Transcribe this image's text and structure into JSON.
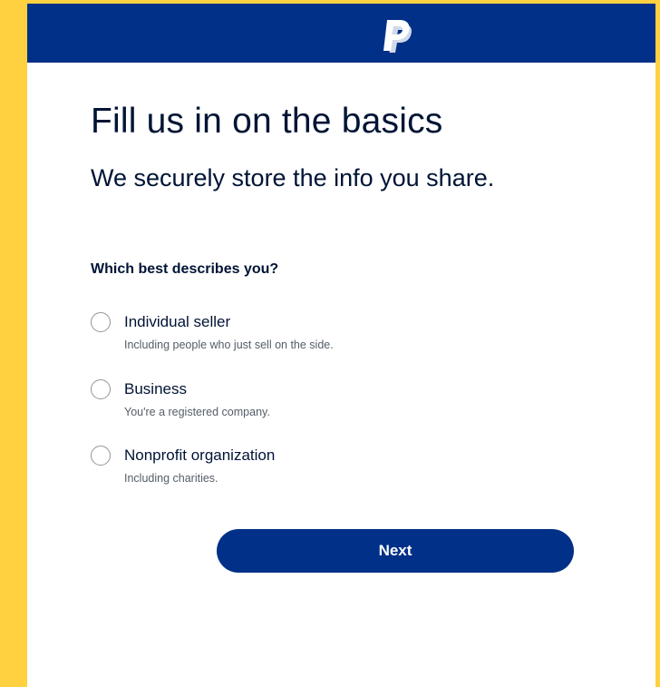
{
  "header": {
    "logo_icon": "paypal-logo-icon",
    "background_color": "#003087"
  },
  "page": {
    "title": "Fill us in on the basics",
    "subtitle": "We securely store the info you share.",
    "question": "Which best describes you?",
    "background_accent": "#FFD140"
  },
  "options": [
    {
      "label": "Individual seller",
      "description": "Including people who just sell on the side.",
      "selected": false
    },
    {
      "label": "Business",
      "description": "You're a registered company.",
      "selected": false
    },
    {
      "label": "Nonprofit organization",
      "description": "Including charities.",
      "selected": false
    }
  ],
  "actions": {
    "next_label": "Next",
    "button_color": "#003087"
  }
}
